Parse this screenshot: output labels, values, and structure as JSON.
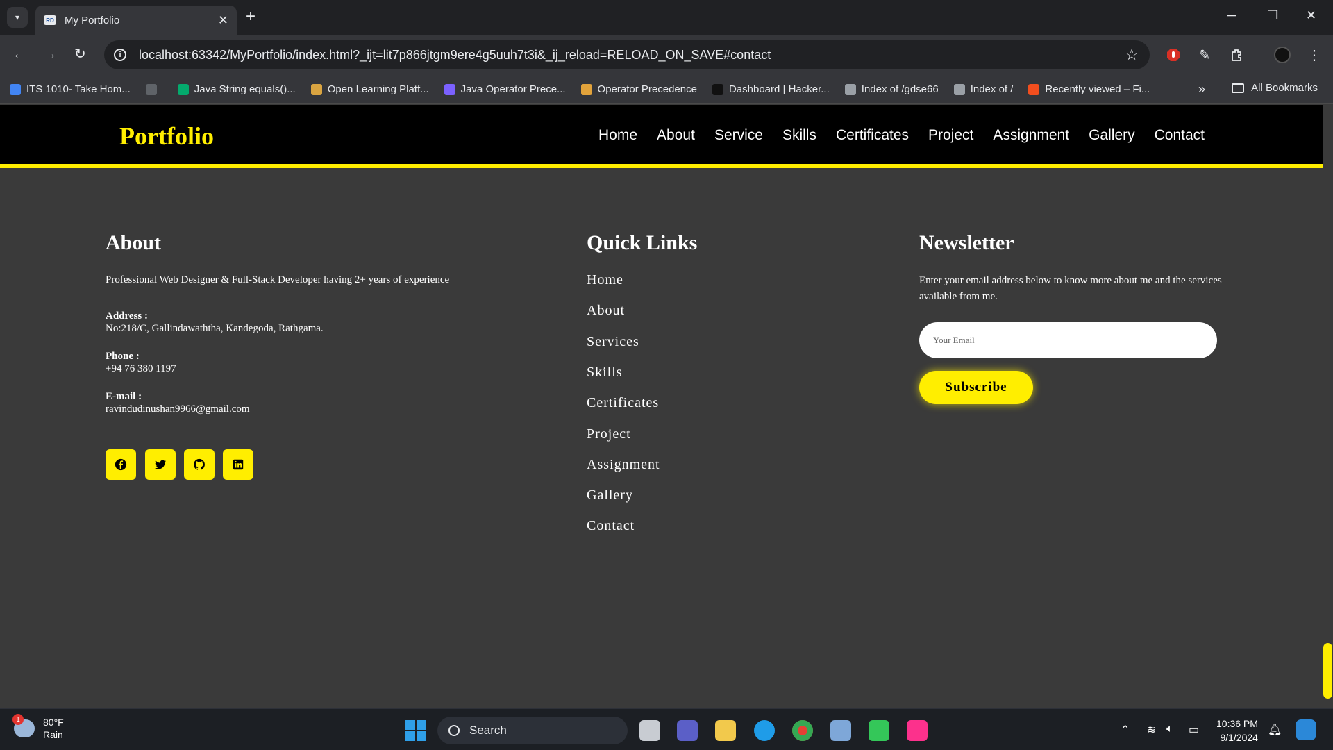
{
  "browser": {
    "tab_title": "My Portfolio",
    "tab_favicon_text": "RD",
    "url": "localhost:63342/MyPortfolio/index.html?_ijt=lit7p866jtgm9ere4g5uuh7t3i&_ij_reload=RELOAD_ON_SAVE#contact",
    "bookmarks": [
      {
        "label": "ITS 1010- Take Hom...",
        "icon": "blue-person-icon",
        "color": "#4285f4"
      },
      {
        "label": "",
        "icon": "github-icon",
        "color": "#5f6368"
      },
      {
        "label": "Java String equals()...",
        "icon": "w3-icon",
        "color": "#04aa6d"
      },
      {
        "label": "Open Learning Platf...",
        "icon": "crest-icon",
        "color": "#d9a441"
      },
      {
        "label": "Java Operator Prece...",
        "icon": "feather-icon",
        "color": "#7b61ff"
      },
      {
        "label": "Operator Precedence",
        "icon": "cubes-icon",
        "color": "#e2a33b"
      },
      {
        "label": "Dashboard | Hacker...",
        "icon": "hackerrank-icon",
        "color": "#111111"
      },
      {
        "label": "Index of /gdse66",
        "icon": "globe-icon",
        "color": "#9aa0a6"
      },
      {
        "label": "Index of /",
        "icon": "globe-icon",
        "color": "#9aa0a6"
      },
      {
        "label": "Recently viewed – Fi...",
        "icon": "figma-icon",
        "color": "#f24e1e"
      }
    ],
    "all_bookmarks": "All Bookmarks"
  },
  "site": {
    "logo": "Portfolio",
    "nav": [
      "Home",
      "About",
      "Service",
      "Skills",
      "Certificates",
      "Project",
      "Assignment",
      "Gallery",
      "Contact"
    ]
  },
  "footer": {
    "about": {
      "heading": "About",
      "text": "Professional Web Designer & Full-Stack Developer having 2+ years of experience",
      "address_label": "Address :",
      "address": "No:218/C, Gallindawaththa, Kandegoda, Rathgama.",
      "phone_label": "Phone :",
      "phone": "+94 76 380 1197",
      "email_label": "E-mail :",
      "email": "ravindudinushan9966@gmail.com",
      "socials": [
        "facebook-icon",
        "twitter-icon",
        "github-icon",
        "linkedin-icon"
      ]
    },
    "quick_links": {
      "heading": "Quick Links",
      "items": [
        "Home",
        "About",
        "Services",
        "Skills",
        "Certificates",
        "Project",
        "Assignment",
        "Gallery",
        "Contact"
      ]
    },
    "newsletter": {
      "heading": "Newsletter",
      "text": "Enter your email address below to know more about me and the services available from me.",
      "placeholder": "Your Email",
      "button": "Subscribe"
    }
  },
  "colors": {
    "accent": "#ffee00",
    "footer_bg": "#3a3a3a",
    "nav_bg": "#000000"
  },
  "taskbar": {
    "weather_temp": "80°F",
    "weather_desc": "Rain",
    "weather_badge": "1",
    "search_label": "Search",
    "time": "10:36 PM",
    "date": "9/1/2024"
  }
}
